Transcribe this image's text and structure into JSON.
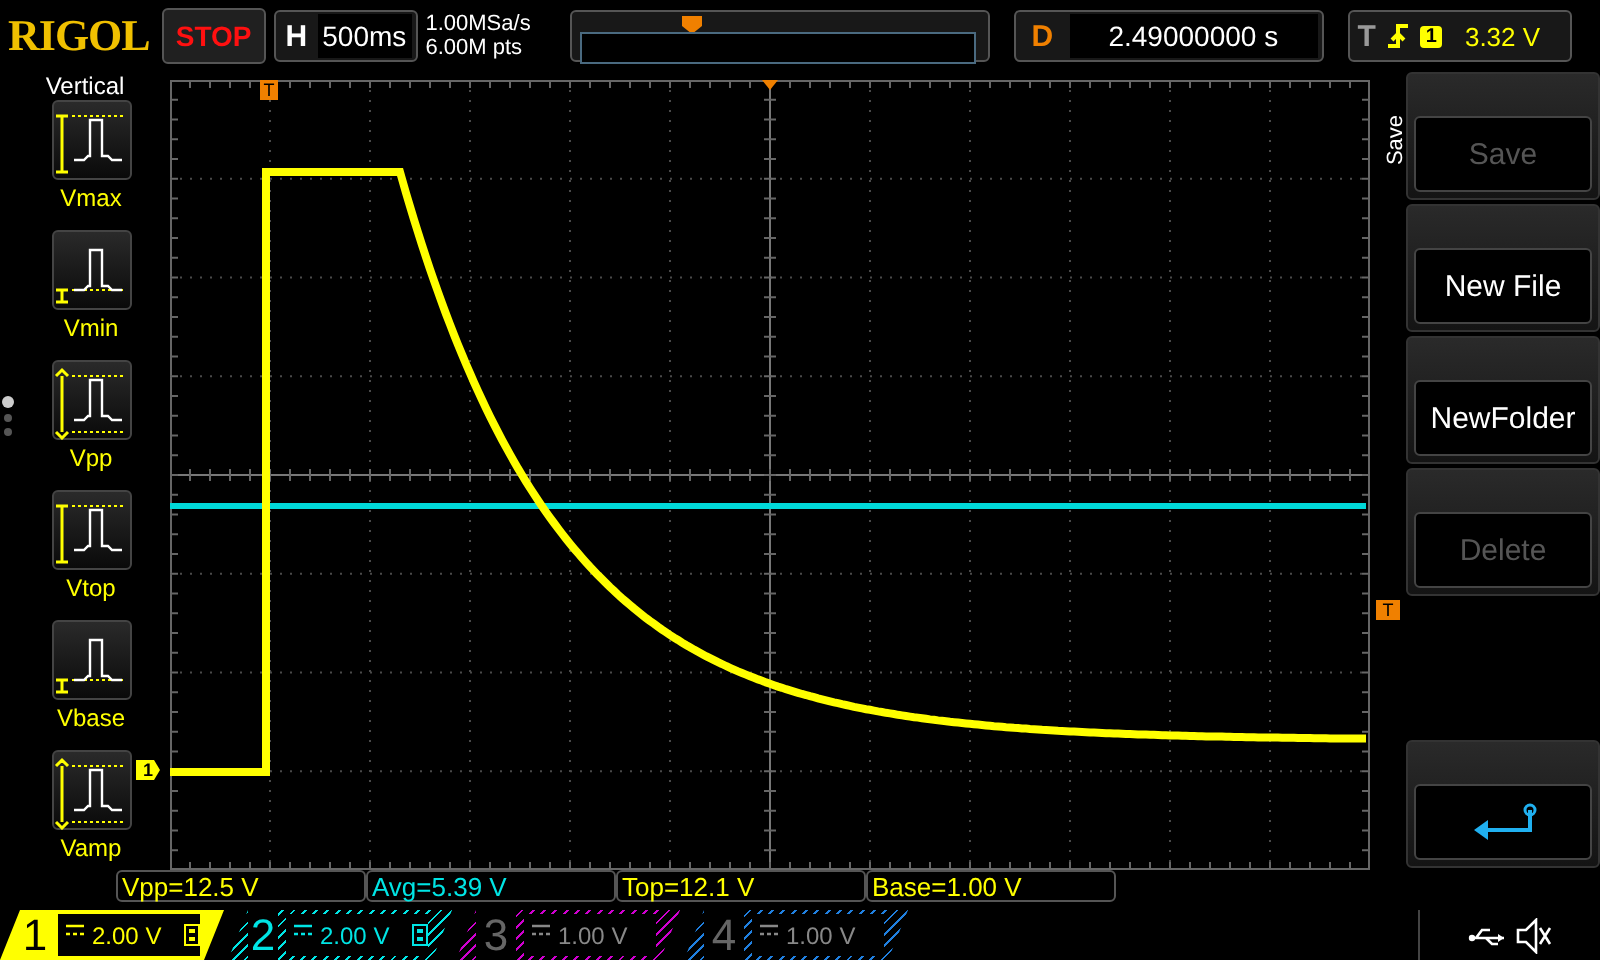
{
  "brand": "RIGOL",
  "run_state": {
    "label": "STOP",
    "running": false
  },
  "timebase": {
    "label": "H",
    "value": "500ms"
  },
  "acquisition": {
    "sample_rate": "1.00MSa/s",
    "memory_depth": "6.00M pts"
  },
  "delay": {
    "label": "D",
    "value": "2.49000000 s"
  },
  "trigger": {
    "label": "T",
    "channel": "1",
    "level": "3.32 V"
  },
  "left_menu": {
    "title": "Vertical",
    "items": [
      {
        "label": "Vmax",
        "kind": "max"
      },
      {
        "label": "Vmin",
        "kind": "min"
      },
      {
        "label": "Vpp",
        "kind": "pp"
      },
      {
        "label": "Vtop",
        "kind": "max"
      },
      {
        "label": "Vbase",
        "kind": "min"
      },
      {
        "label": "Vamp",
        "kind": "pp"
      }
    ],
    "pages": [
      {
        "selected": true
      },
      {
        "selected": false
      },
      {
        "selected": false
      }
    ]
  },
  "plot": {
    "channel_marker": "1",
    "trigger_marker": "T",
    "trigger_position_marker": "T"
  },
  "right_menu": {
    "title": "Save",
    "buttons": [
      {
        "label": "Save",
        "disabled": true
      },
      {
        "label": "New File",
        "disabled": false
      },
      {
        "label": "NewFolder",
        "disabled": false
      },
      {
        "label": "Delete",
        "disabled": true
      }
    ]
  },
  "measurements": [
    {
      "text": "Vpp=12.5 V",
      "color": "#ffff00"
    },
    {
      "text": "Avg=5.39 V",
      "color": "#00e5e5"
    },
    {
      "text": "Top=12.1 V",
      "color": "#ffff00"
    },
    {
      "text": "Base=1.00 V",
      "color": "#ffff00"
    }
  ],
  "channels": [
    {
      "number": "1",
      "scale": "2.00 V",
      "on": true,
      "selected": true,
      "color": "#ffff00"
    },
    {
      "number": "2",
      "scale": "2.00 V",
      "on": true,
      "selected": false,
      "color": "#00e5e5"
    },
    {
      "number": "3",
      "scale": "1.00 V",
      "on": false,
      "selected": false,
      "color": "#d000d0"
    },
    {
      "number": "4",
      "scale": "1.00 V",
      "on": false,
      "selected": false,
      "color": "#2080e0"
    }
  ]
}
